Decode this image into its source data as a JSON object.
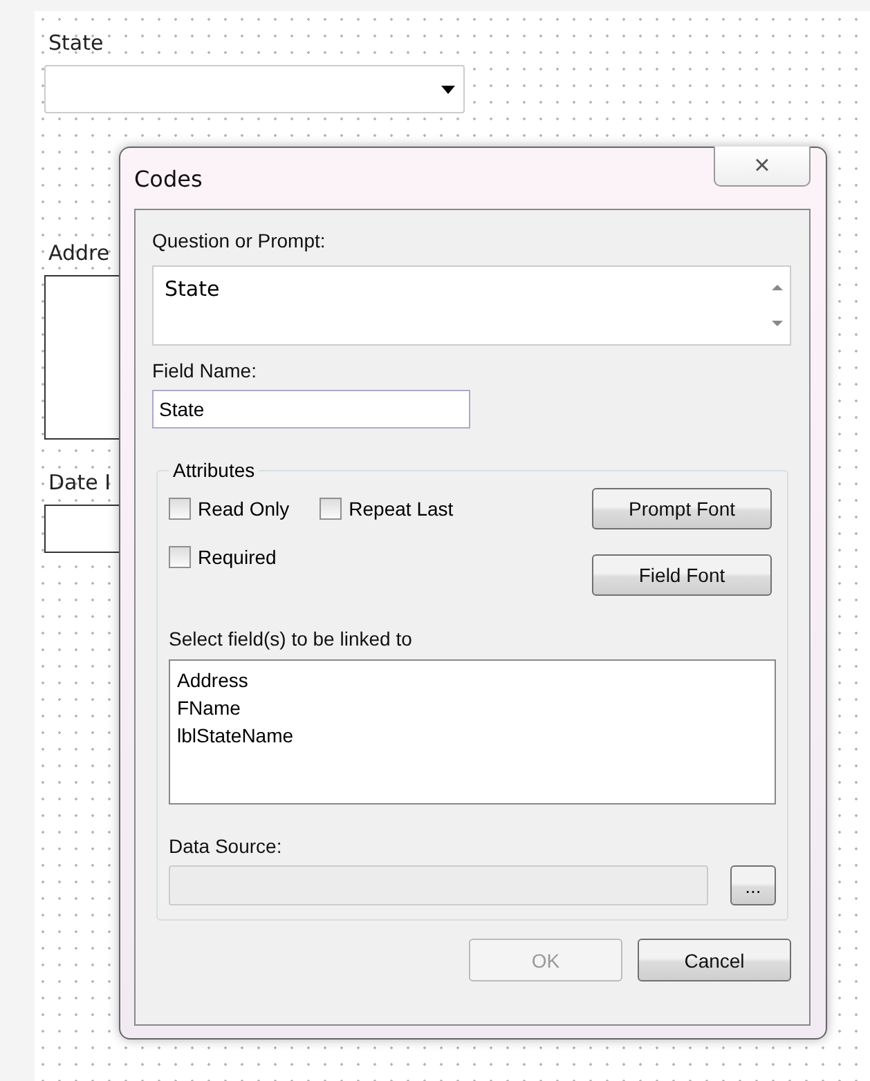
{
  "form": {
    "fields": [
      {
        "label": "State",
        "kind": "dropdown"
      },
      {
        "label": "Addre",
        "kind": "textarea"
      },
      {
        "label": "Date I",
        "kind": "input"
      }
    ]
  },
  "dialog": {
    "title": "Codes",
    "close": "×",
    "prompt_label": "Question or Prompt:",
    "prompt_value": "State",
    "field_name_label": "Field Name:",
    "field_name_value": "State",
    "attributes": {
      "legend": "Attributes",
      "checkboxes": [
        {
          "label": "Read Only",
          "checked": false
        },
        {
          "label": "Repeat Last",
          "checked": false
        },
        {
          "label": "Required",
          "checked": false
        }
      ],
      "buttons": [
        {
          "label": "Prompt Font",
          "disabled": false
        },
        {
          "label": "Field Font",
          "disabled": false
        }
      ],
      "link_label": "Select field(s) to be linked to",
      "link_items": [
        "Address",
        "FName",
        "lblStateName"
      ],
      "data_source_label": "Data Source:",
      "browse": "..."
    },
    "buttons": [
      {
        "label": "OK",
        "disabled": true
      },
      {
        "label": "Cancel",
        "disabled": false
      }
    ]
  }
}
